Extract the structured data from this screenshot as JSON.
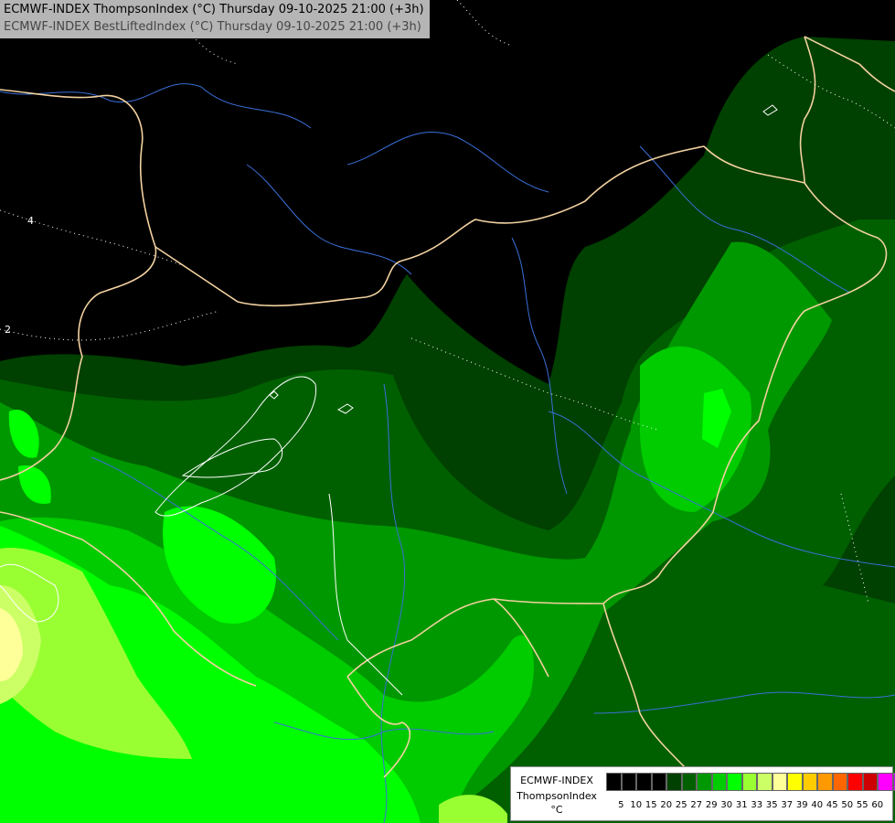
{
  "header": {
    "line1": "ECMWF-INDEX ThompsonIndex (°C) Thursday 09-10-2025 21:00 (+3h)",
    "line2": "ECMWF-INDEX BestLiftedIndex (°C) Thursday 09-10-2025 21:00 (+3h)"
  },
  "contour_labels": [
    "4",
    "2"
  ],
  "legend": {
    "label1": "ECMWF-INDEX",
    "label2": "ThompsonIndex",
    "label3": "°C",
    "colors": [
      "#000000",
      "#000000",
      "#000000",
      "#000000",
      "#004000",
      "#006000",
      "#009800",
      "#00cc00",
      "#00ff00",
      "#99ff33",
      "#ccff66",
      "#ffff99",
      "#ffff00",
      "#ffcc00",
      "#ff9900",
      "#ff6600",
      "#ff0000",
      "#cc0000",
      "#ff00ff",
      "#cc00ff",
      "#9900ff",
      "#6600ff",
      "#3300ff",
      "#0000ff"
    ],
    "ticks": [
      "5",
      "10",
      "15",
      "20",
      "25",
      "27",
      "29",
      "30",
      "31",
      "33",
      "35",
      "37",
      "39",
      "40",
      "45",
      "50",
      "55",
      "60"
    ]
  },
  "colors": {
    "borders": "#f2d1a0",
    "rivers": "#3a6fd8",
    "contours": "#ffffff"
  }
}
